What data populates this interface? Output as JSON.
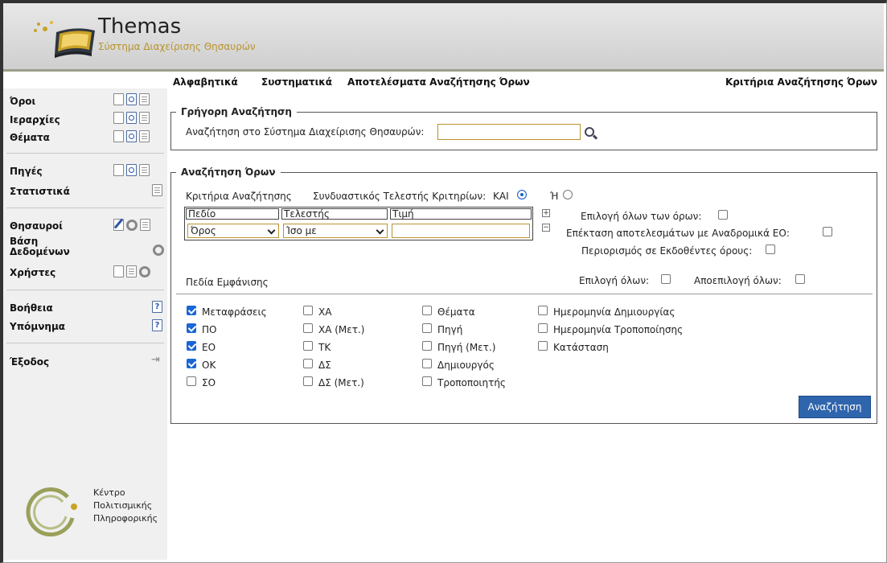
{
  "app": {
    "title": "Themas",
    "subtitle": "Σύστημα Διαχείρισης Θησαυρών"
  },
  "tabs": [
    {
      "label": "Αλφαβητικά"
    },
    {
      "label": "Συστηματικά"
    },
    {
      "label": "Αποτελέσματα Αναζήτησης Όρων"
    },
    {
      "label": "Κριτήρια Αναζήτησης Όρων"
    }
  ],
  "sidebar": {
    "items": [
      {
        "label": "Όροι",
        "icons": [
          "new-doc-icon",
          "search-doc-icon",
          "list-doc-icon"
        ]
      },
      {
        "label": "Ιεραρχίες",
        "icons": [
          "new-doc-icon",
          "search-doc-icon",
          "list-doc-icon"
        ]
      },
      {
        "label": "Θέματα",
        "icons": [
          "new-doc-icon",
          "search-doc-icon",
          "list-doc-icon"
        ]
      },
      {
        "label": "Πηγές",
        "icons": [
          "new-doc-icon",
          "search-doc-icon",
          "list-doc-icon"
        ]
      },
      {
        "label": "Στατιστικά",
        "icons": [
          "list-doc-icon"
        ]
      },
      {
        "label": "Θησαυροί",
        "icons": [
          "edit-icon",
          "gear-icon",
          "list-doc-icon"
        ]
      },
      {
        "label": "Βάση Δεδομένων",
        "icons": [
          "gear-icon"
        ]
      },
      {
        "label": "Χρήστες",
        "icons": [
          "new-doc-icon",
          "list-doc-icon",
          "gear-icon"
        ]
      },
      {
        "label": "Βοήθεια",
        "icons": [
          "help-icon"
        ]
      },
      {
        "label": "Υπόμνημα",
        "icons": [
          "help-icon"
        ]
      },
      {
        "label": "Έξοδος",
        "icons": [
          "exit-icon"
        ]
      }
    ],
    "org_lines": [
      "Κέντρο",
      "Πολιτισμικής",
      "Πληροφορικής"
    ]
  },
  "quick_search": {
    "legend": "Γρήγορη Αναζήτηση",
    "label": "Αναζήτηση στο Σύστημα Διαχείρισης Θησαυρών:",
    "value": ""
  },
  "term_search": {
    "legend": "Αναζήτηση Όρων",
    "criteria_label": "Κριτήρια Αναζήτησης",
    "operator_label": "Συνδυαστικός Τελεστής Κριτηρίων:",
    "op_and": "ΚΑΙ",
    "op_or": "Ή",
    "selected_operator": "ΚΑΙ",
    "grid_headers": [
      "Πεδίο",
      "Τελεστής",
      "Τιμή"
    ],
    "field_value": "Όρος",
    "operator_value": "Ίσο με",
    "text_value": "",
    "options": [
      {
        "label": "Επιλογή όλων των όρων:",
        "checked": false
      },
      {
        "label": "Επέκταση αποτελεσμάτων με Αναδρομικά ΕΟ:",
        "checked": false
      },
      {
        "label": "Περιορισμός σε Εκδοθέντες όρους:",
        "checked": false
      }
    ],
    "display_label": "Πεδία Εμφάνισης",
    "select_all": "Επιλογή όλων:",
    "deselect_all": "Αποεπιλογή όλων:",
    "fields_col1": [
      {
        "label": "Μεταφράσεις",
        "checked": true
      },
      {
        "label": "ΠΟ",
        "checked": true
      },
      {
        "label": "ΕΟ",
        "checked": true
      },
      {
        "label": "ΟΚ",
        "checked": true
      },
      {
        "label": "ΣΟ",
        "checked": false
      }
    ],
    "fields_col2": [
      {
        "label": "ΧΑ",
        "checked": false
      },
      {
        "label": "ΧΑ (Μετ.)",
        "checked": false
      },
      {
        "label": "ΤΚ",
        "checked": false
      },
      {
        "label": "ΔΣ",
        "checked": false
      },
      {
        "label": "ΔΣ (Μετ.)",
        "checked": false
      }
    ],
    "fields_col3": [
      {
        "label": "Θέματα",
        "checked": false
      },
      {
        "label": "Πηγή",
        "checked": false
      },
      {
        "label": "Πηγή (Μετ.)",
        "checked": false
      },
      {
        "label": "Δημιουργός",
        "checked": false
      },
      {
        "label": "Τροποποιητής",
        "checked": false
      }
    ],
    "fields_col4": [
      {
        "label": "Ημερομηνία Δημιουργίας",
        "checked": false
      },
      {
        "label": "Ημερομηνία Τροποποίησης",
        "checked": false
      },
      {
        "label": "Κατάσταση",
        "checked": false
      }
    ],
    "search_button": "Αναζήτηση"
  }
}
